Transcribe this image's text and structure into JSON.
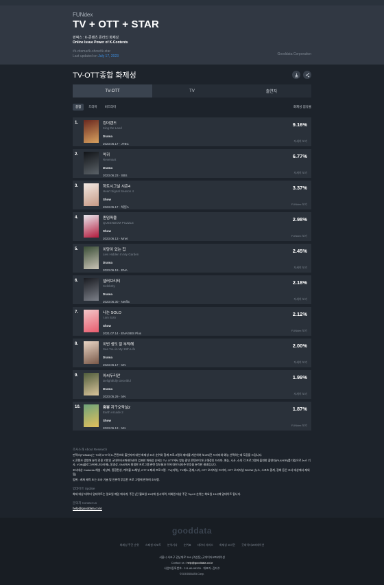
{
  "header": {
    "brand": "FUNdex",
    "title": "TV + OTT + STAR",
    "desc_ko": "펀덱스 : K-콘텐츠 온라인 화제성",
    "desc_en": "Online Issue Power of K-Contents",
    "tags": "#k-drama#k-show#k-star",
    "updated_label": "Last updated on",
    "updated_date": "July 17, 2023",
    "corp": "Gooddata Corporation"
  },
  "section": {
    "title": "TV-OTT종합 화제성",
    "download_icon": "download-icon",
    "share_icon": "share-icon"
  },
  "tabs": [
    "TV-OTT",
    "TV",
    "출연자"
  ],
  "filters": {
    "chips": [
      "종합",
      "드라마",
      "비드라마"
    ],
    "right": "화제성 점유율"
  },
  "more_label": "자세히 보기",
  "items": [
    {
      "rank": "1.",
      "kname": "킹더랜드",
      "ename": "King the Land",
      "genre": "Drama",
      "date": "2023.06.17 · JTBC",
      "pct": "9.16%",
      "more": "자세히 보기",
      "c1": "#6b2a20",
      "c2": "#d8a15f"
    },
    {
      "rank": "2.",
      "kname": "악귀",
      "ename": "Revenant",
      "genre": "Drama",
      "date": "2023.06.23 · SBS",
      "pct": "6.77%",
      "more": "자세히 보기",
      "c1": "#111418",
      "c2": "#5b6268"
    },
    {
      "rank": "3.",
      "kname": "하트시그널 시즌4",
      "ename": "Heart Signal Season 4",
      "genre": "Show",
      "date": "2023.05.17 · 채널A",
      "pct": "3.37%",
      "more": "FUNdex 보기",
      "c1": "#f1e8e2",
      "c2": "#c79a86"
    },
    {
      "rank": "4.",
      "kname": "퀸덤퍼즐",
      "ename": "QUEENDOM PUZZLE",
      "genre": "Show",
      "date": "2023.06.13 · Mnet",
      "pct": "2.98%",
      "more": "FUNdex 보기",
      "c1": "#e8e8ee",
      "c2": "#b31a3c"
    },
    {
      "rank": "5.",
      "kname": "이당이 있는 집",
      "ename": "Lies Hidden In My Garden",
      "genre": "Drama",
      "date": "2023.06.19 · ENA",
      "pct": "2.45%",
      "more": "자세히 보기",
      "c1": "#3a4e37",
      "c2": "#c9c3b6"
    },
    {
      "rank": "6.",
      "kname": "셀러브리티",
      "ename": "Celebrity",
      "genre": "Drama",
      "date": "2023.06.30 · Netflix",
      "pct": "2.18%",
      "more": "자세히 보기",
      "c1": "#1a1c22",
      "c2": "#7b7f88"
    },
    {
      "rank": "7.",
      "kname": "나는 SOLO",
      "ename": "I am Solo",
      "genre": "Show",
      "date": "2021.07.14 · ENA/SBS Plus",
      "pct": "2.12%",
      "more": "FUNdex 보기",
      "c1": "#f3c7c9",
      "c2": "#e85c6e"
    },
    {
      "rank": "8.",
      "kname": "이번 생도 잘 부탁해",
      "ename": "See You in My 19th Life",
      "genre": "Drama",
      "date": "2023.06.17 · tvN",
      "pct": "2.00%",
      "more": "자세히 보기",
      "c1": "#e9d6c6",
      "c2": "#7b5a4a"
    },
    {
      "rank": "9.",
      "kname": "아씨두리안",
      "ename": "Delightfully Deceitful",
      "genre": "Drama",
      "date": "2023.05.29 · tvN",
      "pct": "1.99%",
      "more": "자세히 보기",
      "c1": "#4f5d3c",
      "c2": "#d9c49a"
    },
    {
      "rank": "10.",
      "kname": "뿅뿅 지구오락실2",
      "ename": "Earth Arcade 2",
      "genre": "Show",
      "date": "2023.06.13 · tvN",
      "pct": "1.87%",
      "more": "FUNdex 보기",
      "c1": "#6ea37a",
      "c2": "#e2c05c"
    }
  ],
  "about": {
    "heading": "조사소개 About Research",
    "p1": "펀덱스(FUNdex)는 TV와 OTT의 K-콘텐츠와 출연자에 대한 화제성 조사 순위와 함께 프로그램의 재미를 계산하여 보고되던 드라마와 예능 선택하는데 도움을 드립니다.",
    "p2": "K-콘텐츠 생방에 분석 전용 기반인 굿데이터코퍼레이션이 엄표한 화제성 순위는 TV, OTT에서 방송 중인 콘텐츠이거나 예정인 드라마, 예능, 시사, 쇼의 각 프로그램에 출연한 출연자(PLAYER)를 대상으로 뉴스 기사, VON(블로그/커뮤니티/카페), 동영상, SNS에서 발생한 프로그램 관련 정보들과 이에 대한 네티즌 반응을 분석한 결과입니다.",
    "p3": "조사대상 Contents 채널 : 지상파, 종합편성, 케이블 34채널, OTT 5 폐쇄 프로그램 : TV(지역), TV제노,경제,시사, OTT 오리지널 드라마, OTT 오리지널 SHOW (뉴스, 스포츠 중계, 경화 등은 조사 대상에서 제외됨)",
    "p4": "범위 : 캐쳐 제작 또는 조사 기술 및 인위적 투입된 프로 그램에 한하여 조사함.",
    "update_heading": "업데이트 Update",
    "update_text": "화제 대상 데이터 업데이트는 일요일 매일 에서게, 주간 (전 월요일 13시에 실시하며, 비회원 대상 주간 Top10 순위는 화요일 13시에 업데이트 됩니다.",
    "contact_heading": "문의처 Contact us",
    "email": "help@gooddata.co.kr"
  },
  "footer": {
    "logo": "gooddata",
    "menu": [
      "화제성 주간 순위",
      "스페셜 리포트",
      "분석기사",
      "순위표",
      "데이터 서비스",
      "화제성 조사란",
      "굿데이터코퍼레이션"
    ],
    "address": "서울시 서초구 강남대로 309 (역삼동) 굿데이터코퍼레이션",
    "contact_label": "Contact us :",
    "contact_email": "help@gooddata.co.kr",
    "bizno": "사업자등록번호 : 211-86-95333 · 대표자: 김지수",
    "copyright": "©GOODDATA Corp."
  }
}
